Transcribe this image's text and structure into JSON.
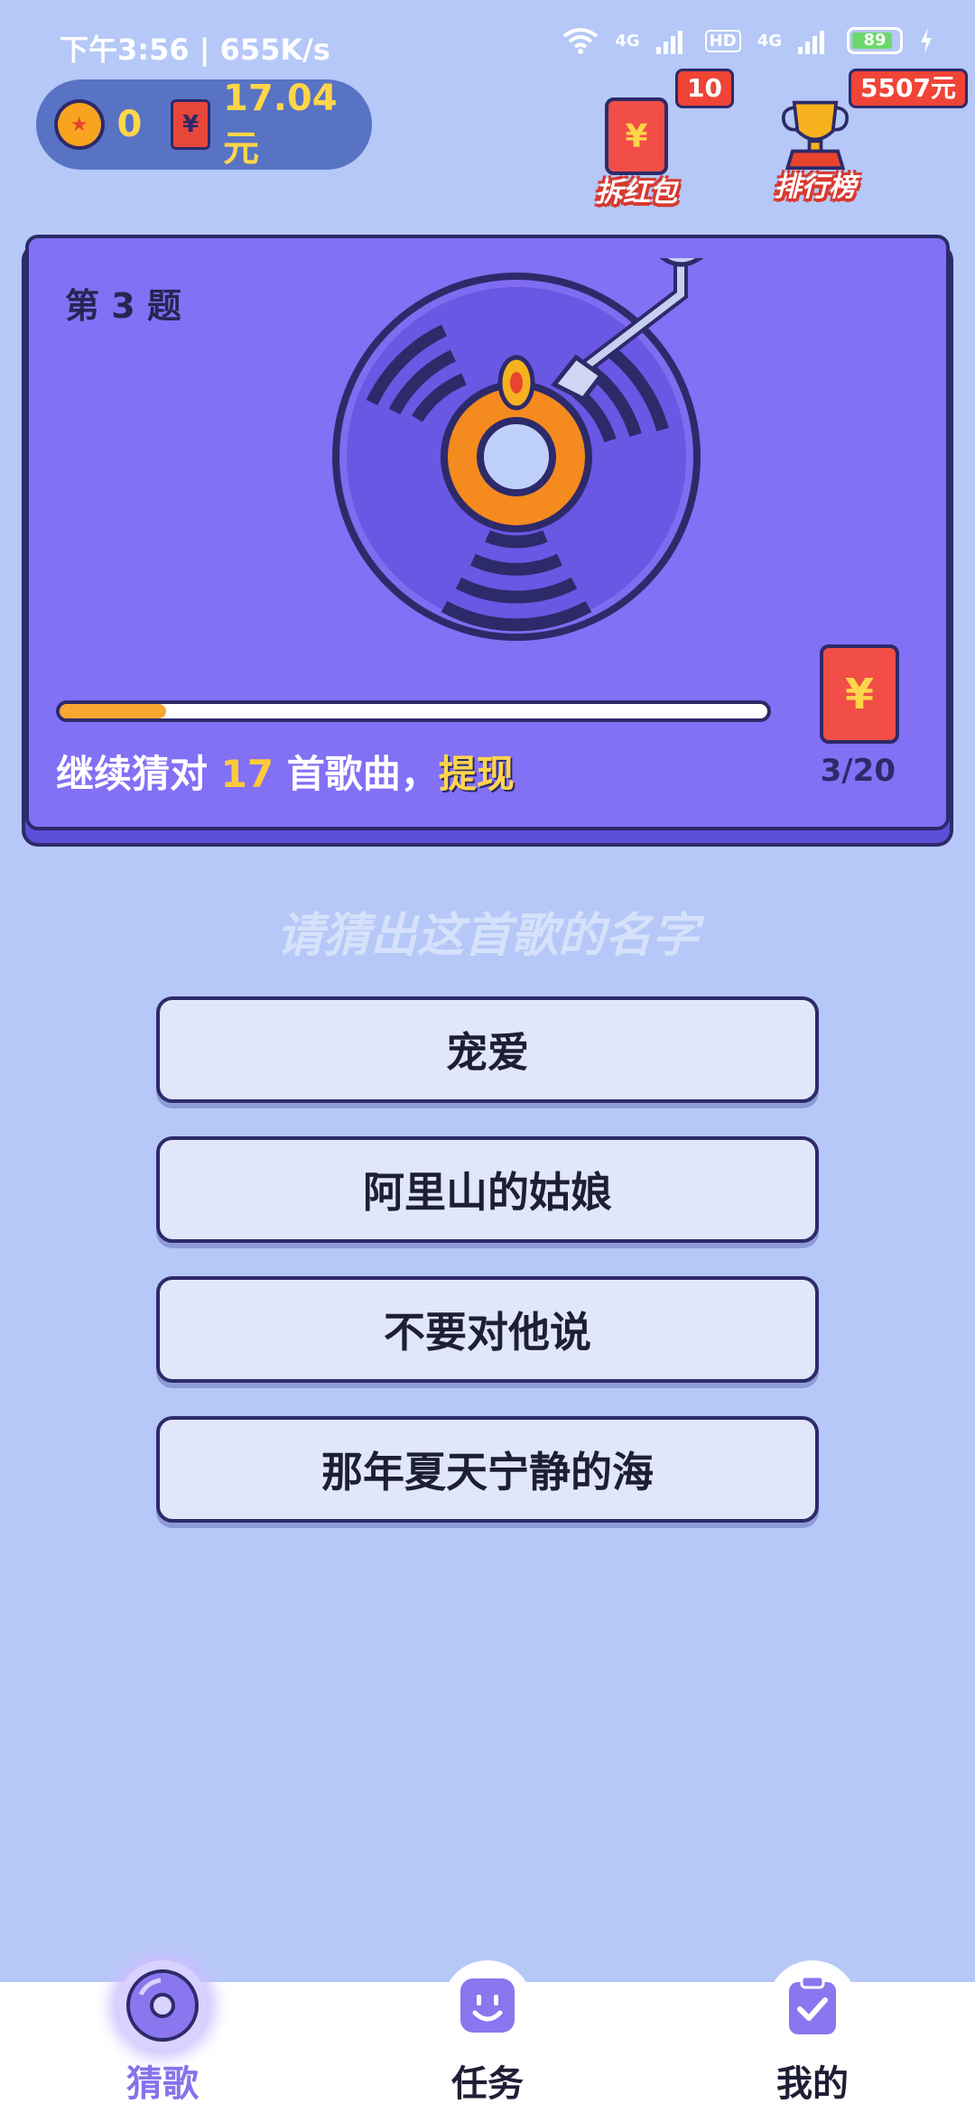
{
  "status": {
    "time": "下午3:56 | 655K/s",
    "network_1": "4G",
    "network_2": "4G",
    "hd": "HD",
    "battery": "89"
  },
  "wallet": {
    "coins": "0",
    "cash": "17.04元"
  },
  "widgets": {
    "redpack_label": "拆红包",
    "redpack_badge": "10",
    "rank_label": "排行榜",
    "rank_badge": "5507元"
  },
  "card": {
    "question_label": "第 3 题",
    "progress": 0.15,
    "continue_prefix": "继续猜对",
    "continue_count": "17",
    "continue_suffix": "首歌曲，",
    "withdraw_label": "提现",
    "counter": "3/20",
    "redpack_symbol": "¥"
  },
  "prompt": "请猜出这首歌的名字",
  "options": [
    "宠爱",
    "阿里山的姑娘",
    "不要对他说",
    "那年夏天宁静的海"
  ],
  "nav": {
    "items": [
      {
        "label": "猜歌"
      },
      {
        "label": "任务"
      },
      {
        "label": "我的"
      }
    ]
  },
  "colors": {
    "background": "#b5c8f7",
    "card": "#8270f5",
    "outline": "#2d2a6a",
    "accent": "#f8a731",
    "nav_active": "#8673ea"
  }
}
